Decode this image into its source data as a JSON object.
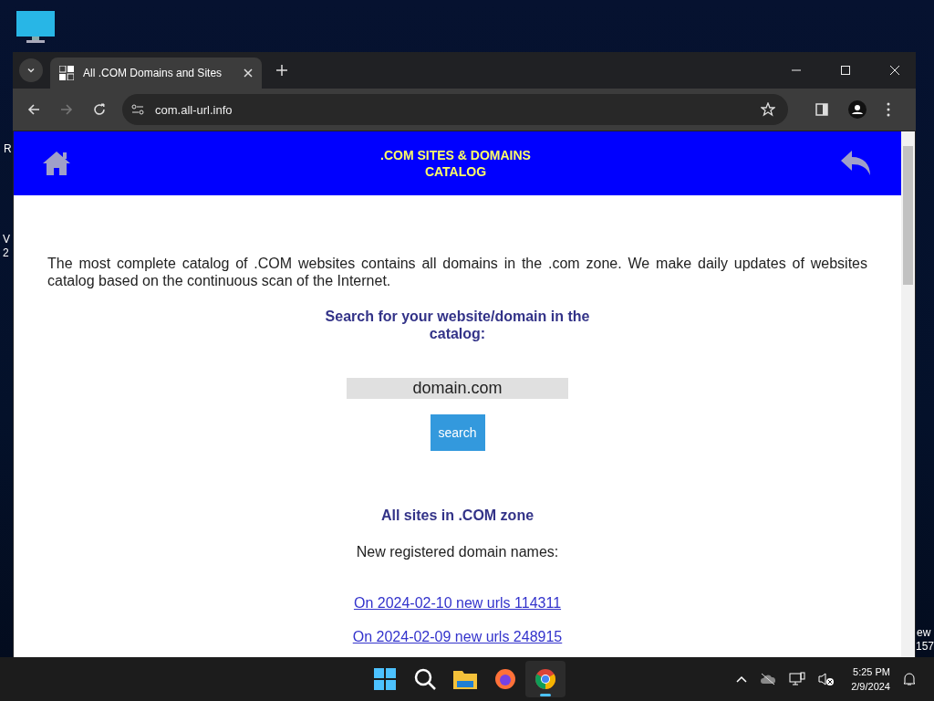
{
  "desktop": {
    "fragments": [
      {
        "text": "R"
      },
      {
        "text": "V"
      },
      {
        "text": "2"
      },
      {
        "text": "ew"
      },
      {
        "text": "157"
      }
    ]
  },
  "browser": {
    "tabs": [
      {
        "title": "All .COM Domains and Sites",
        "selected": true
      }
    ],
    "address": "com.all-url.info"
  },
  "page": {
    "header": {
      "title": ".COM SITES & DOMAINS CATALOG"
    },
    "intro": "The most complete catalog of .COM websites contains all domains in the .com zone. We make daily updates of websites catalog based on the continuous scan of the Internet.",
    "search": {
      "heading": "Search for your website/domain in the catalog:",
      "placeholder": "domain.com",
      "button": "search"
    },
    "zone_heading": "All sites in .COM zone",
    "new_label": "New registered domain names:",
    "links": [
      "On 2024-02-10 new urls 114311",
      "On 2024-02-09 new urls 248915"
    ]
  },
  "taskbar": {
    "apps": [
      {
        "kind": "start",
        "active": false
      },
      {
        "kind": "search",
        "active": false
      },
      {
        "kind": "files",
        "active": false
      },
      {
        "kind": "firefox",
        "active": false
      },
      {
        "kind": "chrome",
        "active": true
      }
    ],
    "time": "5:25 PM",
    "date": "2/9/2024"
  }
}
